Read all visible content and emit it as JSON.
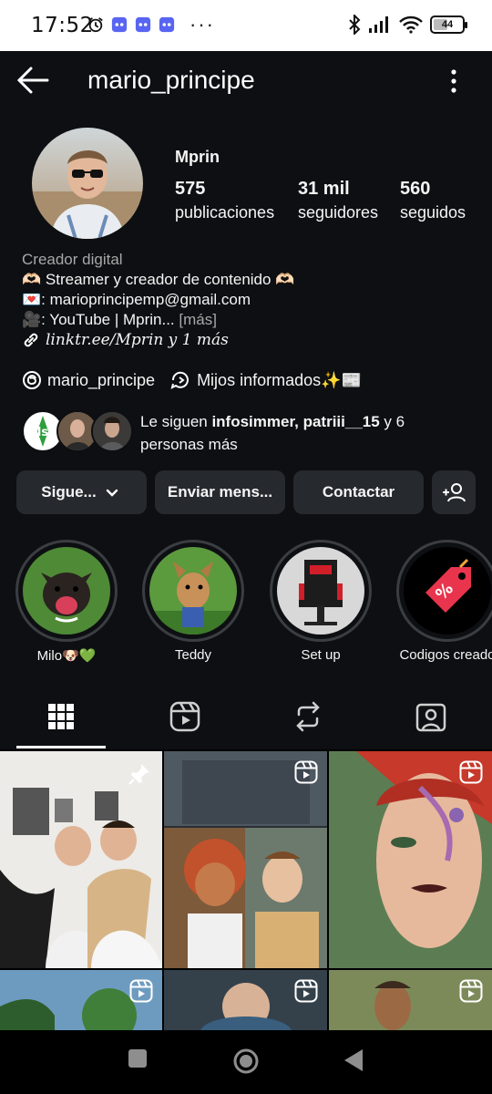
{
  "status_bar": {
    "time": "17:52",
    "battery": "44"
  },
  "header": {
    "username": "mario_principe"
  },
  "profile": {
    "display_name": "Mprin",
    "stats": [
      {
        "value": "575",
        "label": "publicaciones"
      },
      {
        "value": "31 mil",
        "label": "seguidores"
      },
      {
        "value": "560",
        "label": "seguidos"
      }
    ],
    "category": "Creador digital",
    "bio_line1": "🫶🏻 Streamer y creador de contenido 🫶🏻",
    "bio_line2": "💌: marioprincipemp@gmail.com",
    "bio_line3": "🎥: YouTube | Mprin...",
    "bio_more": "[más]",
    "link": "linktr.ee/Mprin y 1 más",
    "threads_handle": "mario_principe",
    "channel_name": "Mijos informados✨📰",
    "followed_by_prefix": "Le siguen ",
    "followed_by_names": "infosimmer, patriii__15",
    "followed_by_suffix": " y 6",
    "followed_by_line2": "personas más"
  },
  "actions": {
    "following": "Sigue...",
    "message": "Enviar mens...",
    "contact": "Contactar"
  },
  "highlights": [
    {
      "label": "Milo🐶💚"
    },
    {
      "label": "Teddy"
    },
    {
      "label": "Set up"
    },
    {
      "label": "Codigos creado"
    }
  ],
  "tabs": [
    {
      "icon": "grid-icon",
      "active": true
    },
    {
      "icon": "reels-icon",
      "active": false
    },
    {
      "icon": "repost-icon",
      "active": false
    },
    {
      "icon": "tagged-icon",
      "active": false
    }
  ],
  "colors": {
    "background": "#0d0f12",
    "button": "#26292e",
    "muted_text": "#a8a8a8"
  }
}
